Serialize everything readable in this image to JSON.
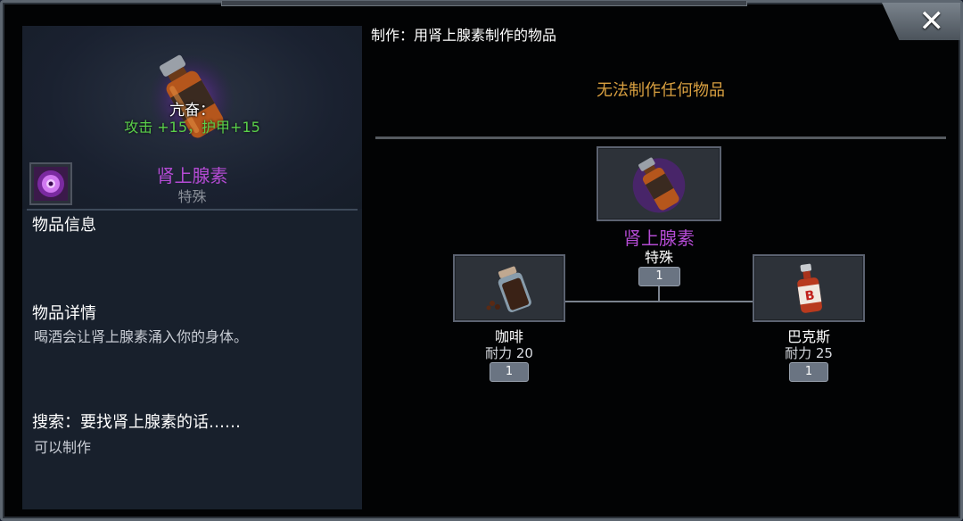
{
  "window": {
    "close_label": "✕"
  },
  "item": {
    "buff_name": "亢奋：",
    "buff_stats": "攻击 +15，护甲+15",
    "name": "肾上腺素",
    "category": "特殊",
    "colors": {
      "name": "#b44bd4",
      "buff": "#5ad04a"
    }
  },
  "info": {
    "info_title": "物品信息",
    "details_title": "物品详情",
    "details_text": "喝酒会让肾上腺素涌入你的身体。",
    "search_title": "搜索：要找肾上腺素的话……",
    "search_text": "可以制作"
  },
  "crafting": {
    "header": "制作：用肾上腺素制作的物品",
    "empty_message": "无法制作任何物品",
    "result": {
      "name": "肾上腺素",
      "category": "特殊",
      "count": "1",
      "icon": "adrenaline-bottle-icon"
    },
    "ingredients": [
      {
        "name": "咖啡",
        "stat": "耐力 20",
        "count": "1",
        "icon": "coffee-jar-icon"
      },
      {
        "name": "巴克斯",
        "stat": "耐力 25",
        "count": "1",
        "icon": "bacchus-bottle-icon"
      }
    ]
  }
}
